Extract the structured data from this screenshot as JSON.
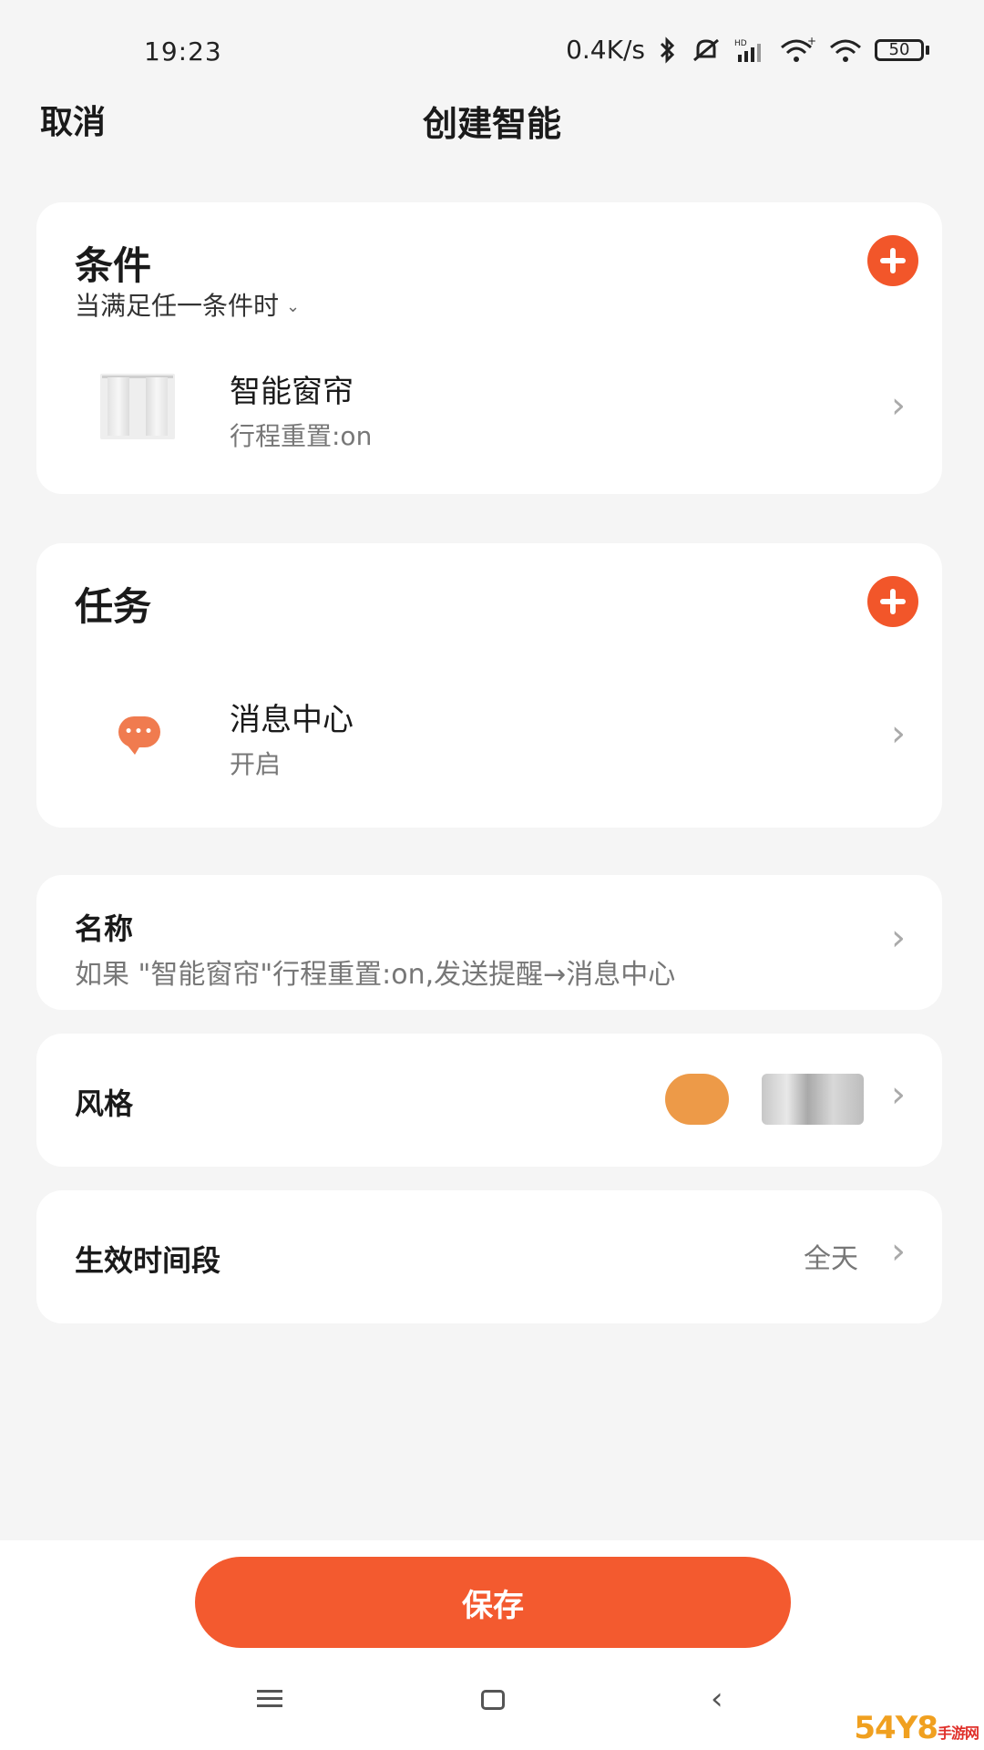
{
  "status_bar": {
    "time": "19:23",
    "network_speed": "0.4K/s",
    "battery": "50"
  },
  "header": {
    "cancel_label": "取消",
    "title": "创建智能"
  },
  "conditions": {
    "title": "条件",
    "match_mode": "当满足任一条件时",
    "items": [
      {
        "title": "智能窗帘",
        "subtitle": "行程重置:on",
        "icon": "curtain-icon"
      }
    ]
  },
  "tasks": {
    "title": "任务",
    "items": [
      {
        "title": "消息中心",
        "subtitle": "开启",
        "icon": "message-bubble-icon"
      }
    ]
  },
  "name_setting": {
    "label": "名称",
    "value": "如果 \"智能窗帘\"行程重置:on,发送提醒→消息中心"
  },
  "style_setting": {
    "label": "风格",
    "color": "#ed9a48"
  },
  "time_setting": {
    "label": "生效时间段",
    "value": "全天"
  },
  "save_label": "保存",
  "colors": {
    "accent": "#f35a2f",
    "background": "#f5f5f5"
  },
  "watermark": {
    "text": "54Y8",
    "sub": "手游网"
  }
}
